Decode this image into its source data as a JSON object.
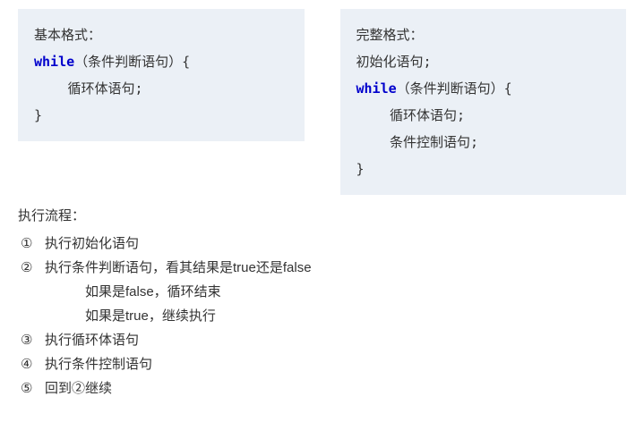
{
  "basic": {
    "title": "基本格式：",
    "line1_kw": "while",
    "line1_rest": "（条件判断语句）{",
    "line2": "循环体语句;",
    "line3": "}"
  },
  "full": {
    "title": "完整格式：",
    "line1": "初始化语句;",
    "line2_kw": "while",
    "line2_rest": "（条件判断语句）{",
    "line3": "循环体语句;",
    "line4": "条件控制语句;",
    "line5": "}"
  },
  "flow": {
    "title": "执行流程：",
    "s1_num": "①",
    "s1_txt": "执行初始化语句",
    "s2_num": "②",
    "s2_txt": "执行条件判断语句，看其结果是true还是false",
    "s2a": "如果是false，循环结束",
    "s2b": "如果是true，继续执行",
    "s3_num": "③",
    "s3_txt": "执行循环体语句",
    "s4_num": "④",
    "s4_txt": "执行条件控制语句",
    "s5_num": "⑤",
    "s5_txt": "回到②继续"
  }
}
